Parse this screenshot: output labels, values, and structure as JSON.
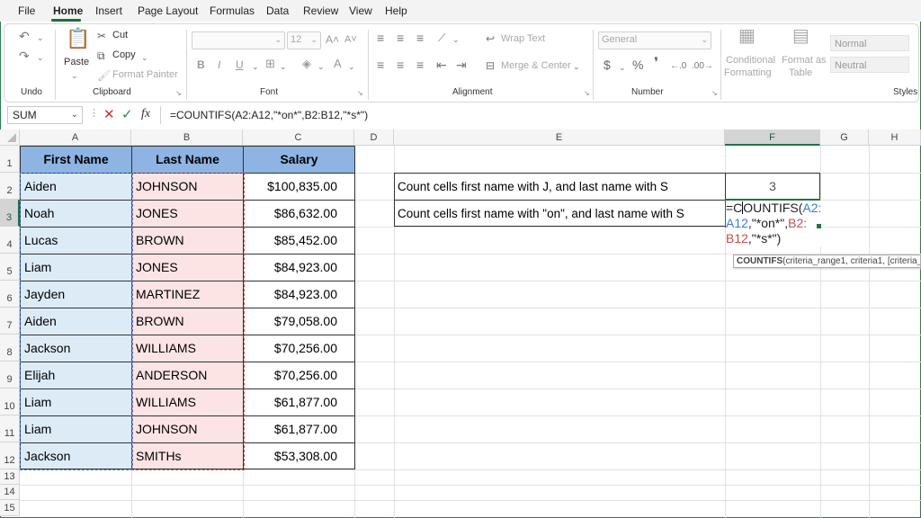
{
  "menu": {
    "items": [
      "File",
      "Home",
      "Insert",
      "Page Layout",
      "Formulas",
      "Data",
      "Review",
      "View",
      "Help"
    ],
    "active": "Home"
  },
  "ribbon": {
    "undo_label": "Undo",
    "clipboard": {
      "paste": "Paste",
      "cut": "Cut",
      "copy": "Copy",
      "format_painter": "Format Painter",
      "label": "Clipboard"
    },
    "font": {
      "size": "12",
      "label": "Font"
    },
    "alignment": {
      "wrap_text": "Wrap Text",
      "merge_center": "Merge & Center",
      "label": "Alignment"
    },
    "number": {
      "format": "General",
      "label": "Number"
    },
    "styles": {
      "conditional": [
        "Conditional",
        "Formatting"
      ],
      "format_as": [
        "Format as",
        "Table"
      ],
      "normal": "Normal",
      "neutral": "Neutral",
      "label": "Styles"
    }
  },
  "formula_bar": {
    "name_box": "SUM",
    "fx": "fx",
    "formula": "=COUNTIFS(A2:A12,\"*on*\",B2:B12,\"*s*\")"
  },
  "columns": [
    "A",
    "B",
    "C",
    "D",
    "E",
    "F",
    "G",
    "H"
  ],
  "rows": [
    "1",
    "2",
    "3",
    "4",
    "5",
    "6",
    "7",
    "8",
    "9",
    "10",
    "11",
    "12",
    "13",
    "14",
    "15"
  ],
  "table": {
    "headers": [
      "First Name",
      "Last Name",
      "Salary"
    ],
    "rows": [
      [
        "Aiden",
        "JOHNSON",
        "$100,835.00"
      ],
      [
        "Noah",
        "JONES",
        "$86,632.00"
      ],
      [
        "Lucas",
        "BROWN",
        "$85,452.00"
      ],
      [
        "Liam",
        "JONES",
        "$84,923.00"
      ],
      [
        "Jayden",
        "MARTINEZ",
        "$84,923.00"
      ],
      [
        "Aiden",
        "BROWN",
        "$79,058.00"
      ],
      [
        "Jackson",
        "WILLIAMS",
        "$70,256.00"
      ],
      [
        "Elijah",
        "ANDERSON",
        "$70,256.00"
      ],
      [
        "Liam",
        "WILLIAMS",
        "$61,877.00"
      ],
      [
        "Liam",
        "JOHNSON",
        "$61,877.00"
      ],
      [
        "Jackson",
        "SMITHs",
        "$53,308.00"
      ]
    ]
  },
  "side": {
    "q1": "Count cells first name with J, and last name with S",
    "a1": "3",
    "q2": "Count cells first name with \"on\", and last name with S",
    "edit": {
      "p1": "=C",
      "p2": "OUNTIFS(",
      "p3": "A2:",
      "p4": "A12",
      "p5": ",\"*on*\",",
      "p6": "B2:",
      "p7": "B12",
      "p8": ",\"*s*\")"
    },
    "tooltip_fn": "COUNTIFS",
    "tooltip_args": "(criteria_range1, criteria1, [criteria_"
  },
  "colors": {
    "accent": "#217346",
    "header_fill": "#8db4e2",
    "col_a_fill": "#ddebf7",
    "col_b_fill": "#fce4e4",
    "ref_blue": "#3b7bd6",
    "ref_red": "#c0504d"
  }
}
